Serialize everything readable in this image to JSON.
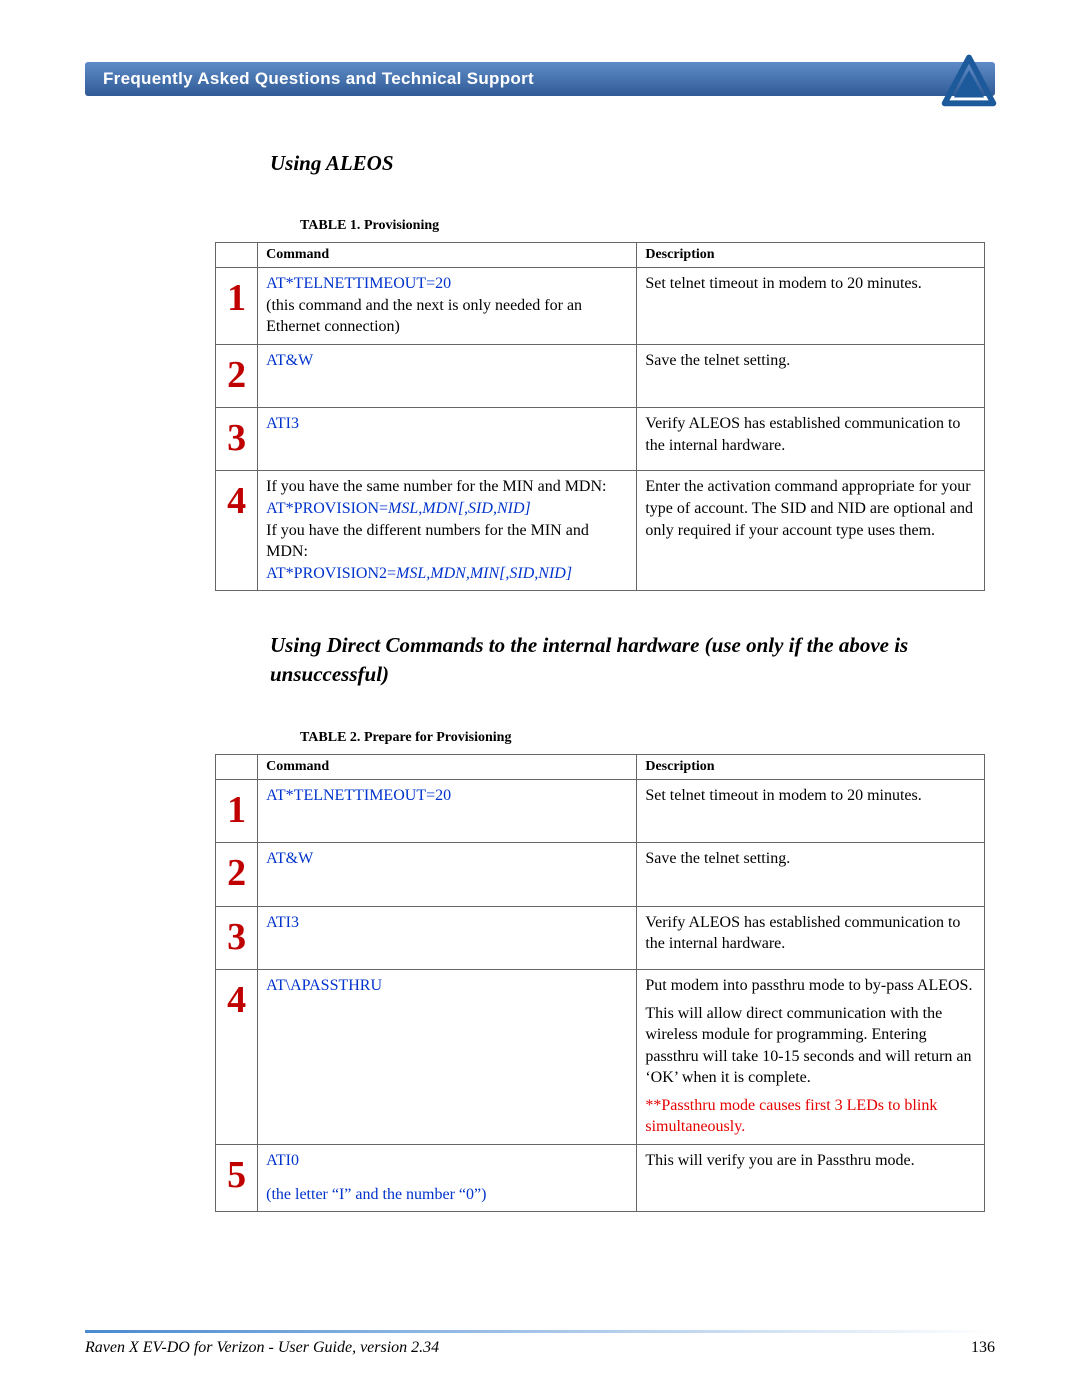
{
  "header": {
    "title": "Frequently Asked Questions and Technical Support"
  },
  "section1": {
    "title": "Using ALEOS"
  },
  "table1": {
    "caption_label": "TABLE 1. ",
    "caption_text": "Provisioning",
    "head_cmd": "Command",
    "head_desc": "Description",
    "rows": [
      {
        "n": "1",
        "cmd_main": "AT*TELNETTIMEOUT=20",
        "cmd_sub": "(this command and the next is only needed for an Ethernet connection)",
        "desc": "Set telnet timeout in modem to 20 minutes."
      },
      {
        "n": "2",
        "cmd_main": "AT&W",
        "desc": "Save the telnet setting."
      },
      {
        "n": "3",
        "cmd_main": "ATI3",
        "desc": "Verify ALEOS has established communication to the internal hardware."
      },
      {
        "n": "4",
        "pre1": "If you have the same number for the MIN and MDN:",
        "cmd1_a": "AT*PROVISION=",
        "cmd1_b": "MSL,MDN[,SID,NID]",
        "pre2": "If you have the different numbers for the MIN and MDN:",
        "cmd2_a": "AT*PROVISION2=",
        "cmd2_b": "MSL,MDN,MIN[,SID,NID]",
        "desc": "Enter the activation command appropriate for your type of account.  The SID and NID are optional and only required if your account type uses them."
      }
    ]
  },
  "section2": {
    "title": "Using Direct Commands to the internal hardware (use only if the above is unsuccessful)"
  },
  "table2": {
    "caption_label": "TABLE 2. ",
    "caption_text": "Prepare for Provisioning",
    "head_cmd": "Command",
    "head_desc": "Description",
    "rows": [
      {
        "n": "1",
        "cmd_main": "AT*TELNETTIMEOUT=20",
        "desc": "Set telnet timeout in modem to 20 minutes."
      },
      {
        "n": "2",
        "cmd_main": "AT&W",
        "desc": "Save the telnet setting."
      },
      {
        "n": "3",
        "cmd_main": "ATI3",
        "desc": "Verify ALEOS has established communication to the internal hardware."
      },
      {
        "n": "4",
        "cmd_main": "AT\\APASSTHRU",
        "desc_a": "Put modem into passthru mode to by-pass ALEOS.",
        "desc_b": "This will allow direct communication with the wireless module for programming.  Entering passthru will  take  10-15 seconds and will return an ‘OK’ when it is complete.",
        "desc_warn": "**Passthru mode causes first 3 LEDs to blink simultaneously."
      },
      {
        "n": "5",
        "cmd_main": "ATI0",
        "cmd_sub": "(the letter “I” and the number “0”)",
        "desc": "This will verify you are in Passthru mode."
      }
    ]
  },
  "footer": {
    "title": "Raven X EV-DO for Verizon - User Guide, version 2.34",
    "page": "136"
  }
}
